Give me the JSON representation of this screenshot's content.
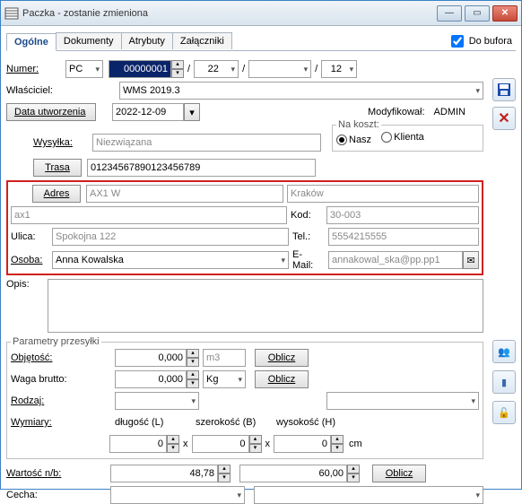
{
  "window": {
    "title": "Paczka - zostanie zmieniona"
  },
  "tabs": {
    "t0": "Ogólne",
    "t1": "Dokumenty",
    "t2": "Atrybuty",
    "t3": "Załączniki",
    "dobufora": "Do bufora"
  },
  "numer": {
    "label": "Numer:",
    "prefix": "PC",
    "main": "00000001",
    "p2": "22",
    "p4": "12"
  },
  "wlasciciel": {
    "label": "Właściciel:",
    "value": "WMS 2019.3"
  },
  "datautw": {
    "btn": "Data utworzenia",
    "value": "2022-12-09"
  },
  "modyf": {
    "label": "Modyfikował:",
    "value": "ADMIN"
  },
  "wysylka": {
    "label": "Wysyłka:",
    "value": "Niezwiązana"
  },
  "trasa": {
    "btn": "Trasa",
    "value": "01234567890123456789"
  },
  "nakoszt": {
    "label": "Na koszt:",
    "opt1": "Nasz",
    "opt2": "Klienta"
  },
  "adres": {
    "btn": "Adres",
    "code": "AX1 W",
    "city": "Kraków",
    "line2": "ax1",
    "kodl": "Kod:",
    "kodv": "30-003",
    "ulical": "Ulica:",
    "ulicav": "Spokojna 122",
    "tell": "Tel.:",
    "telv": "5554215555",
    "osobal": "Osoba:",
    "osobav": "Anna Kowalska",
    "emaill": "E-Mail:",
    "emailv": "annakowal_ska@pp.pp1"
  },
  "opis": {
    "label": "Opis:"
  },
  "param": {
    "legend": "Parametry przesyłki",
    "obj": "Objętość:",
    "objv": "0,000",
    "objunit": "m3",
    "oblicz": "Oblicz",
    "waga": "Waga brutto:",
    "wagav": "0,000",
    "wagaunit": "Kg",
    "rodzaj": "Rodzaj:",
    "wymiary": "Wymiary:",
    "dl": "długość (L)",
    "sz": "szerokość (B)",
    "wy": "wysokość (H)",
    "dim": "0",
    "x": "x",
    "cm": "cm"
  },
  "wartosc": {
    "label": "Wartość n/b:",
    "v1": "48,78",
    "v2": "60,00",
    "oblicz": "Oblicz"
  },
  "cecha": {
    "label": "Cecha:"
  }
}
